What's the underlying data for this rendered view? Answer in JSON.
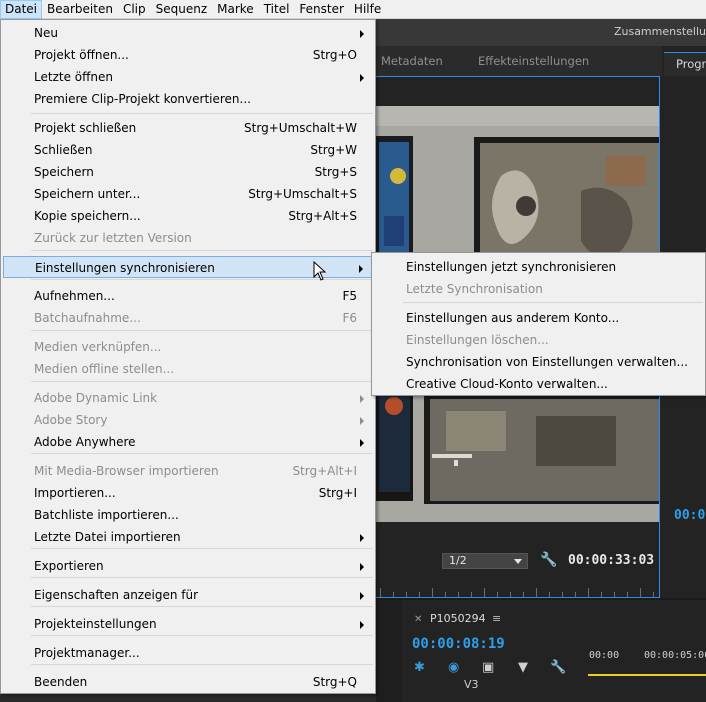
{
  "menubar": {
    "items": [
      "Datei",
      "Bearbeiten",
      "Clip",
      "Sequenz",
      "Marke",
      "Titel",
      "Fenster",
      "Hilfe"
    ],
    "active_index": 0
  },
  "titlebar": {
    "workspace": "Zusammenstellu"
  },
  "source_panel": {
    "tabs": [
      "Metadaten",
      "Effekteinstellungen"
    ],
    "resolution": "1/2",
    "timecode": "00:00:33:03",
    "wrench_icon": "wrench-icon"
  },
  "program_panel": {
    "tab": "Progra",
    "timecode": "00:0"
  },
  "timeline": {
    "sequence_name": "P1050294",
    "timecode": "00:00:08:19",
    "ruler": [
      "00:00",
      "00:00:05:00"
    ],
    "track": "V3"
  },
  "file_menu": {
    "items": [
      {
        "label": "Neu",
        "shortcut": "",
        "submenu": true,
        "disabled": false
      },
      {
        "label": "Projekt öffnen...",
        "shortcut": "Strg+O",
        "submenu": false,
        "disabled": false
      },
      {
        "label": "Letzte öffnen",
        "shortcut": "",
        "submenu": true,
        "disabled": false
      },
      {
        "label": "Premiere Clip-Projekt konvertieren...",
        "shortcut": "",
        "submenu": false,
        "disabled": false
      },
      {
        "label": "Projekt schließen",
        "shortcut": "Strg+Umschalt+W",
        "submenu": false,
        "disabled": false
      },
      {
        "label": "Schließen",
        "shortcut": "Strg+W",
        "submenu": false,
        "disabled": false
      },
      {
        "label": "Speichern",
        "shortcut": "Strg+S",
        "submenu": false,
        "disabled": false
      },
      {
        "label": "Speichern unter...",
        "shortcut": "Strg+Umschalt+S",
        "submenu": false,
        "disabled": false
      },
      {
        "label": "Kopie speichern...",
        "shortcut": "Strg+Alt+S",
        "submenu": false,
        "disabled": false
      },
      {
        "label": "Zurück zur letzten Version",
        "shortcut": "",
        "submenu": false,
        "disabled": true
      },
      {
        "label": "Einstellungen synchronisieren",
        "shortcut": "",
        "submenu": true,
        "disabled": false,
        "highlighted": true
      },
      {
        "label": "Aufnehmen...",
        "shortcut": "F5",
        "submenu": false,
        "disabled": false
      },
      {
        "label": "Batchaufnahme...",
        "shortcut": "F6",
        "submenu": false,
        "disabled": true
      },
      {
        "label": "Medien verknüpfen...",
        "shortcut": "",
        "submenu": false,
        "disabled": true
      },
      {
        "label": "Medien offline stellen...",
        "shortcut": "",
        "submenu": false,
        "disabled": true
      },
      {
        "label": "Adobe Dynamic Link",
        "shortcut": "",
        "submenu": true,
        "disabled": true
      },
      {
        "label": "Adobe Story",
        "shortcut": "",
        "submenu": true,
        "disabled": true
      },
      {
        "label": "Adobe Anywhere",
        "shortcut": "",
        "submenu": true,
        "disabled": false
      },
      {
        "label": "Mit Media-Browser importieren",
        "shortcut": "Strg+Alt+I",
        "submenu": false,
        "disabled": true
      },
      {
        "label": "Importieren...",
        "shortcut": "Strg+I",
        "submenu": false,
        "disabled": false
      },
      {
        "label": "Batchliste importieren...",
        "shortcut": "",
        "submenu": false,
        "disabled": false
      },
      {
        "label": "Letzte Datei importieren",
        "shortcut": "",
        "submenu": true,
        "disabled": false
      },
      {
        "label": "Exportieren",
        "shortcut": "",
        "submenu": true,
        "disabled": false
      },
      {
        "label": "Eigenschaften anzeigen für",
        "shortcut": "",
        "submenu": true,
        "disabled": false
      },
      {
        "label": "Projekteinstellungen",
        "shortcut": "",
        "submenu": true,
        "disabled": false
      },
      {
        "label": "Projektmanager...",
        "shortcut": "",
        "submenu": false,
        "disabled": false
      },
      {
        "label": "Beenden",
        "shortcut": "Strg+Q",
        "submenu": false,
        "disabled": false
      }
    ]
  },
  "sync_submenu": {
    "items": [
      {
        "label": "Einstellungen jetzt synchronisieren",
        "disabled": false
      },
      {
        "label": "Letzte Synchronisation",
        "disabled": true
      },
      {
        "label": "Einstellungen aus anderem Konto...",
        "disabled": false
      },
      {
        "label": "Einstellungen löschen...",
        "disabled": true
      },
      {
        "label": "Synchronisation von Einstellungen verwalten...",
        "disabled": false
      },
      {
        "label": "Creative Cloud-Konto verwalten...",
        "disabled": false
      }
    ]
  },
  "colors": {
    "accent_blue": "#2da0ea",
    "menu_bg": "#f0f0f0",
    "highlight": "#d1e4f5",
    "timeline_marker": "#e5d21e"
  }
}
